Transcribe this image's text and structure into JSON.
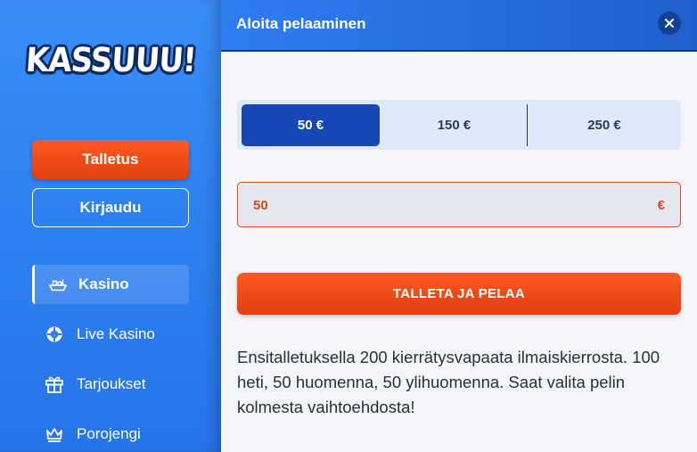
{
  "sidebar": {
    "logo_text": "KASSUUU!",
    "deposit_label": "Talletus",
    "login_label": "Kirjaudu",
    "nav": [
      {
        "label": "Kasino",
        "icon": "casino-boat-icon",
        "active": true
      },
      {
        "label": "Live Kasino",
        "icon": "live-casino-icon",
        "active": false
      },
      {
        "label": "Tarjoukset",
        "icon": "gift-icon",
        "active": false
      },
      {
        "label": "Porojengi",
        "icon": "crown-icon",
        "active": false
      }
    ]
  },
  "modal": {
    "title": "Aloita pelaaminen",
    "amount_options": [
      "50 €",
      "150 €",
      "250 €"
    ],
    "selected_amount_index": 0,
    "input": {
      "value": "50",
      "currency": "€"
    },
    "play_button_label": "TALLETA JA PELAA",
    "info_text": "Ensitalletuksella 200 kierrätysvapaata ilmaiskierrosta. 100 heti, 50 huomenna, 50 ylihuomenna. Saat valita pelin kolmesta vaihtoehdosta!"
  },
  "colors": {
    "accent_orange": "#e84a15",
    "primary_blue": "#1747b5",
    "sidebar_blue": "#2f7ff0"
  }
}
